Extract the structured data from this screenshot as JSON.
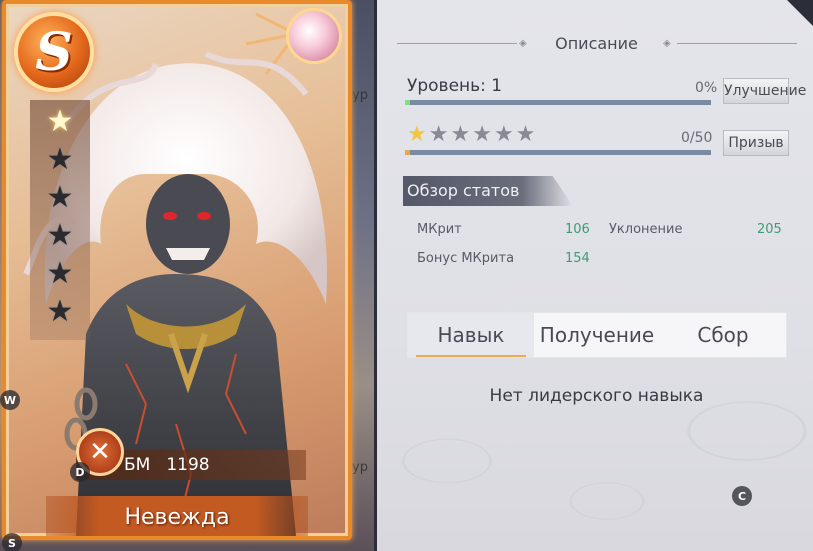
{
  "hero": {
    "rank": "S",
    "stars_total": 6,
    "stars_filled": 1,
    "bm_label": "БМ",
    "bm_value": "1198",
    "name": "Невежда"
  },
  "key_hints": {
    "s": "S",
    "w": "W",
    "d": "D",
    "c": "C"
  },
  "bg_hints": [
    "ур",
    "ур"
  ],
  "panel": {
    "title": "Описание",
    "level_label": "Уровень: 1",
    "level_progress_text": "0%",
    "level_progress": 0.0,
    "upgrade_button": "Улучшение",
    "stars_total": 6,
    "stars_filled": 1,
    "summon_count": "0/50",
    "summon_progress": 0.0,
    "summon_button": "Призыв",
    "stats_header": "Обзор статов",
    "stats": [
      {
        "name": "МКрит",
        "value": "106"
      },
      {
        "name": "Уклонение",
        "value": "205"
      },
      {
        "name": "Бонус МКрита",
        "value": "154"
      }
    ],
    "tabs": [
      "Навык",
      "Получение",
      "Сбор"
    ],
    "active_tab": 0,
    "no_skill_text": "Нет лидерского навыка"
  },
  "colors": {
    "card_border": "#e98a2a",
    "accent_orange": "#f1a850",
    "progress_green": "#7ee07e",
    "stat_value": "#3e9a76",
    "star_gold": "#f3c640"
  }
}
